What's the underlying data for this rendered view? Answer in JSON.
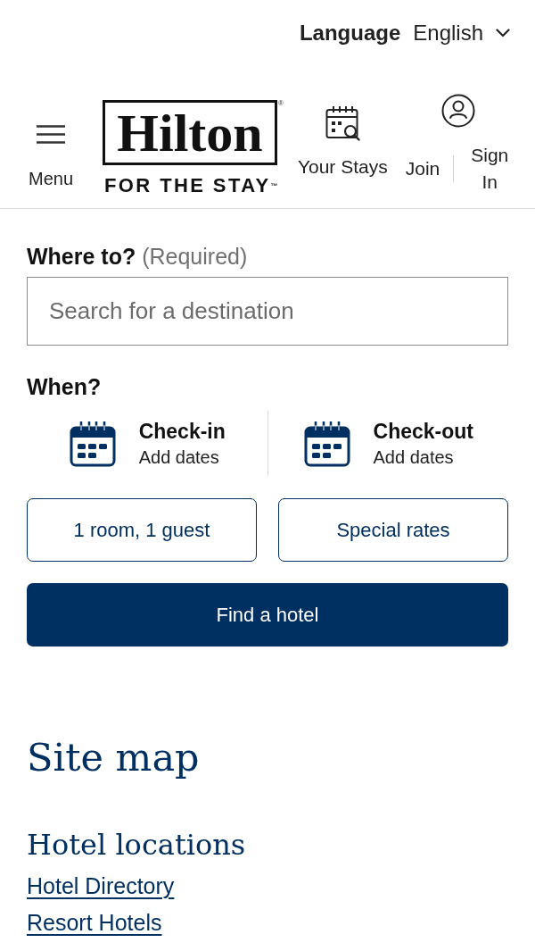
{
  "language": {
    "label": "Language",
    "value": "English"
  },
  "header": {
    "menu_label": "Menu",
    "logo": {
      "wordmark": "Hilton",
      "registered_mark": "®",
      "tagline": "FOR THE STAY$^{™}$"
    },
    "nav": [
      {
        "kind": "stays",
        "label": "Your Stays"
      },
      {
        "kind": "account",
        "links": [
          "Join",
          "Sign In"
        ]
      }
    ]
  },
  "search": {
    "destination": {
      "label": "Where to?",
      "hint": "(Required)",
      "placeholder": "Search for a destination"
    },
    "when": {
      "label": "When?",
      "dates": [
        {
          "label": "Check-in",
          "value": "Add dates"
        },
        {
          "label": "Check-out",
          "value": "Add dates"
        }
      ]
    },
    "options": [
      "1 room, 1 guest",
      "Special rates"
    ],
    "submit": "Find a hotel"
  },
  "site_map": {
    "title": "Site map",
    "sections": [
      {
        "title": "Hotel locations",
        "links": [
          "Hotel Directory",
          "Resort Hotels"
        ]
      }
    ]
  }
}
